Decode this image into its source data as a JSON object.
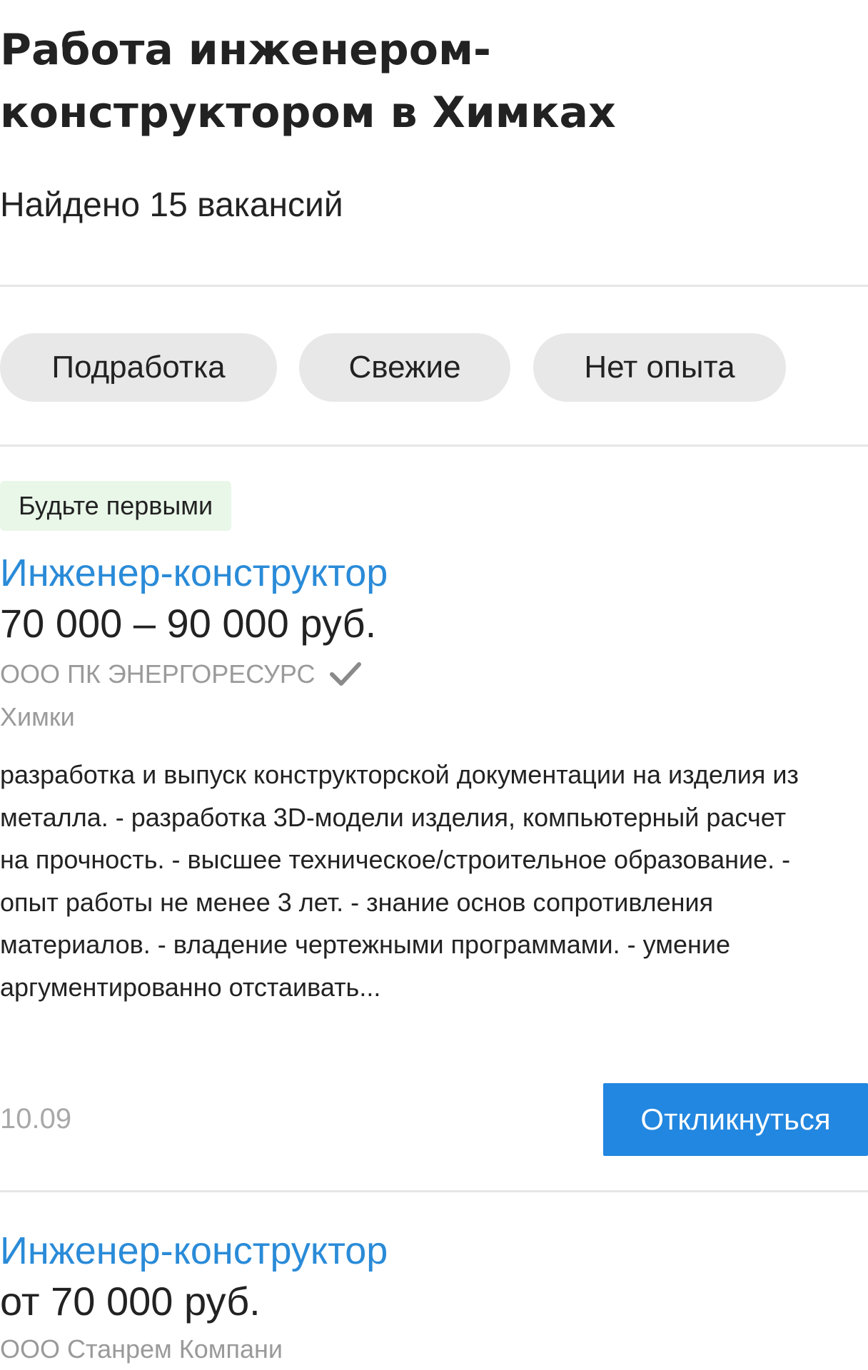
{
  "page": {
    "title": "Работа инженером-конструктором в Химках",
    "found_count": "Найдено 15 вакансий"
  },
  "filters": [
    {
      "label": "Подработка"
    },
    {
      "label": "Свежие"
    },
    {
      "label": "Нет опыта"
    }
  ],
  "jobs": [
    {
      "badge": "Будьте первыми",
      "title": "Инженер-конструктор",
      "salary": "70 000 – 90 000 руб.",
      "company": "ООО ПК ЭНЕРГОРЕСУРС",
      "company_verified_icon": "check-icon",
      "city": "Химки",
      "description": "разработка и выпуск конструкторской документации на изделия из металла. - разработка 3D-модели изделия, компьютерный расчет на прочность. - высшее техническое/строительное образование. - опыт работы не менее 3 лет. - знание основ сопротивления материалов. - владение чертежными программами. - умение аргументированно отстаивать...",
      "date": "10.09",
      "apply_label": "Откликнуться"
    },
    {
      "title": "Инженер-конструктор",
      "salary": "от 70 000 руб.",
      "company": "ООО Станрем Компани"
    }
  ],
  "colors": {
    "link": "#2a8bd8",
    "button": "#2287e0",
    "chip_bg": "#e8e8e8",
    "badge_bg": "#e9f7e9",
    "muted_text": "#9a9a9a"
  }
}
